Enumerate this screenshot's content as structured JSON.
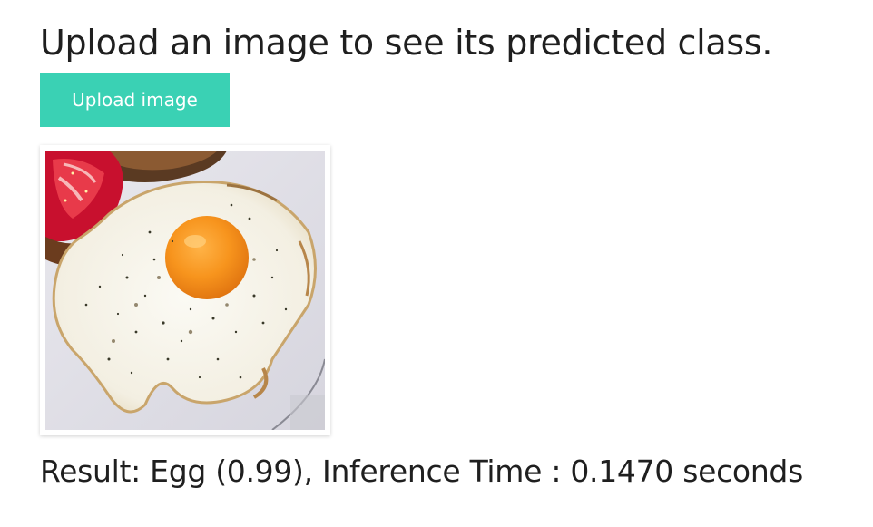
{
  "header": {
    "title": "Upload an image to see its predicted class."
  },
  "upload": {
    "button_label": "Upload image"
  },
  "prediction": {
    "result_text": "Result: Egg (0.99), Inference Time : 0.1470 seconds"
  },
  "colors": {
    "button_bg": "#3ad1b4",
    "button_text": "#ffffff"
  }
}
